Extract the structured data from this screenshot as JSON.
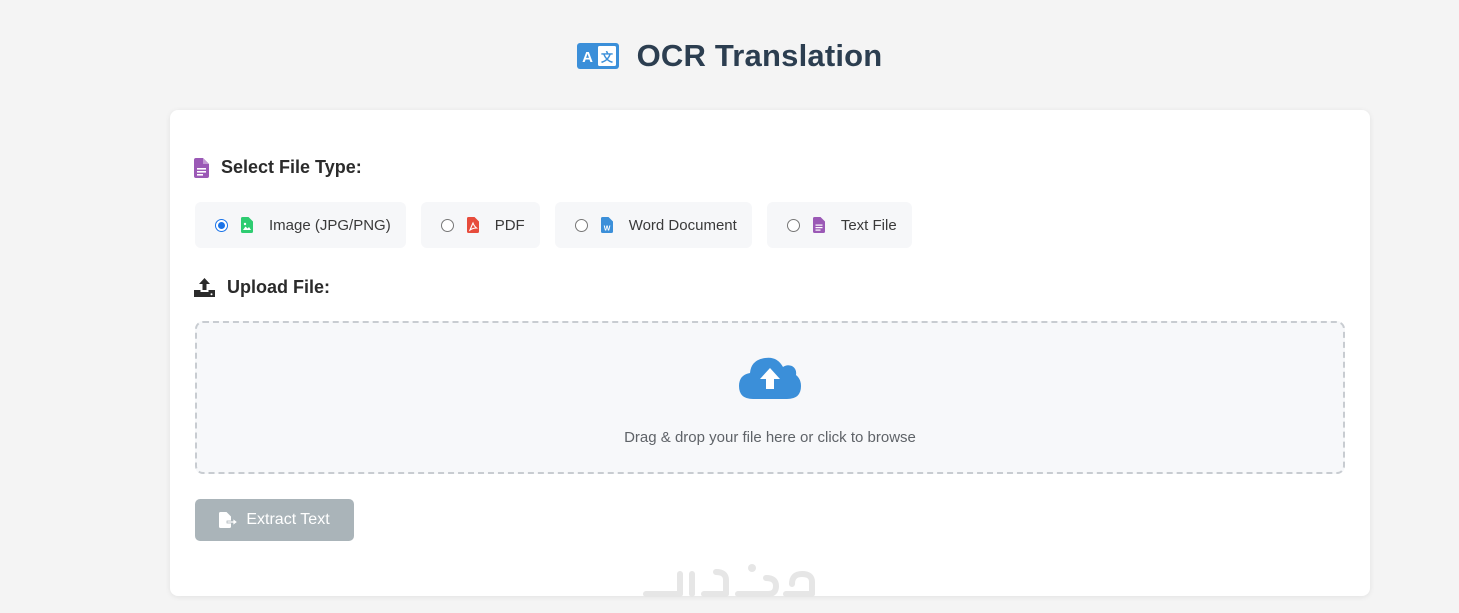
{
  "header": {
    "title": "OCR Translation",
    "icon": "translate-icon",
    "accent": "#3b8fd9"
  },
  "file_type": {
    "label": "Select File Type:",
    "icon": "file-icon",
    "options": [
      {
        "label": "Image (JPG/PNG)",
        "icon": "image-file-icon",
        "color": "#2ecc71",
        "selected": true
      },
      {
        "label": "PDF",
        "icon": "pdf-file-icon",
        "color": "#e74c3c",
        "selected": false
      },
      {
        "label": "Word Document",
        "icon": "word-file-icon",
        "color": "#3b8fd9",
        "selected": false
      },
      {
        "label": "Text File",
        "icon": "text-file-icon",
        "color": "#9b59b6",
        "selected": false
      }
    ]
  },
  "upload": {
    "label": "Upload File:",
    "icon": "upload-icon",
    "dropzone_text": "Drag & drop your file here or click to browse",
    "cloud_icon": "cloud-upload-icon"
  },
  "actions": {
    "extract_label": "Extract Text",
    "extract_icon": "file-export-icon",
    "enabled": false
  },
  "watermark": {
    "icon": "watermark-logo"
  }
}
